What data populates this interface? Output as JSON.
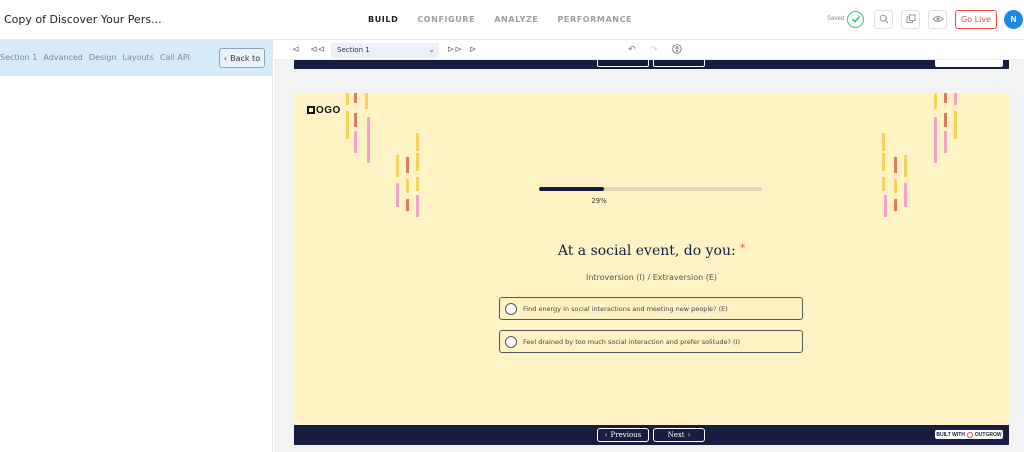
{
  "header": {
    "title": "Copy of Discover Your Pers...",
    "tabs": [
      {
        "label": "BUILD",
        "active": true
      },
      {
        "label": "CONFIGURE",
        "active": false
      },
      {
        "label": "ANALYZE",
        "active": false
      },
      {
        "label": "PERFORMANCE",
        "active": false
      }
    ],
    "saved_label": "Saved",
    "go_live_label": "Go Live",
    "avatar_initial": "N",
    "accent_color": "#e74c3c"
  },
  "sidebar": {
    "tabs": [
      "Section 1",
      "Advanced",
      "Design",
      "Layouts",
      "Call API"
    ],
    "back_label": "Back to"
  },
  "toolbar": {
    "section_value": "Section 1"
  },
  "quiz": {
    "logo_text": "OGO",
    "progress_percent": 29,
    "progress_label": "29%",
    "question": "At a social event, do you:",
    "required_mark": "*",
    "subtitle": "Introversion (I) / Extraversion (E)",
    "options": [
      "Find energy in social interactions and meeting new people? (E)",
      "Feel drained by too much social interaction and prefer solitude? (I)"
    ],
    "previous_label": "Previous",
    "next_label": "Next",
    "built_with_label": "BUILT WITH",
    "built_with_brand": "OUTGROW",
    "brand_color": "#151e3f",
    "card_color": "#fff3c6"
  }
}
